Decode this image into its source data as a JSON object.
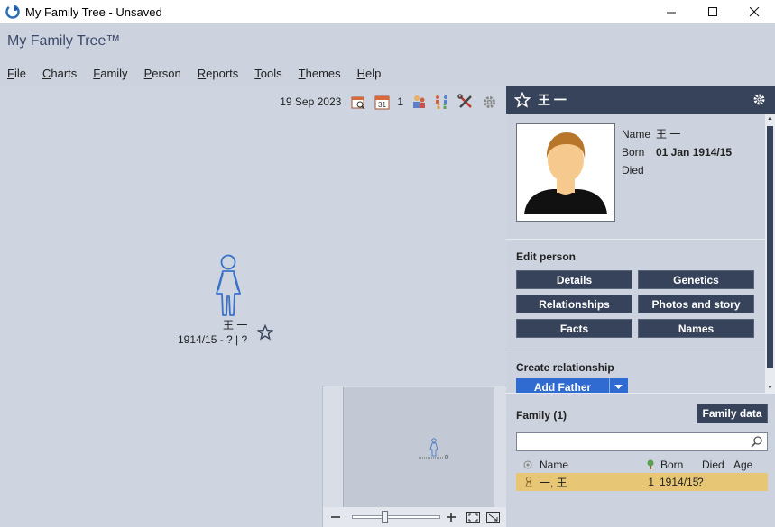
{
  "window": {
    "title": "My Family Tree - Unsaved",
    "controls": [
      "minimize",
      "maximize",
      "close"
    ]
  },
  "app": {
    "title": "My Family Tree™"
  },
  "menu": [
    "File",
    "Charts",
    "Family",
    "Person",
    "Reports",
    "Tools",
    "Themes",
    "Help"
  ],
  "toolbar": {
    "date": "19 Sep 2023",
    "count": "1",
    "icons": [
      "calendar-search-icon",
      "calendar-31-icon",
      "people-icon",
      "family-group-icon",
      "tools-icon",
      "gear-icon"
    ]
  },
  "tree_node": {
    "name": "王 一",
    "dates": "1914/15 - ? | ?",
    "gender": "female"
  },
  "panel": {
    "header_name": "王 一",
    "person": {
      "name_label": "Name",
      "name_value": "王 一",
      "born_label": "Born",
      "born_value": "01 Jan 1914/15",
      "died_label": "Died",
      "died_value": ""
    },
    "edit_person_title": "Edit person",
    "edit_buttons": [
      "Details",
      "Genetics",
      "Relationships",
      "Photos and story",
      "Facts",
      "Names"
    ],
    "create_relationship_title": "Create relationship",
    "add_father_label": "Add Father"
  },
  "family": {
    "title": "Family (1)",
    "data_button": "Family data",
    "search_placeholder": "",
    "columns": {
      "name": "Name",
      "born": "Born",
      "died": "Died",
      "age": "Age"
    },
    "rows": [
      {
        "name": "一, 王",
        "generation": "1",
        "born": "1914/15",
        "died": "?",
        "age": ""
      }
    ]
  },
  "colors": {
    "panel_dark": "#37435a",
    "canvas_bg": "#ced5e1",
    "selected_row": "#e7c776",
    "accent_blue": "#2f6bd0"
  }
}
